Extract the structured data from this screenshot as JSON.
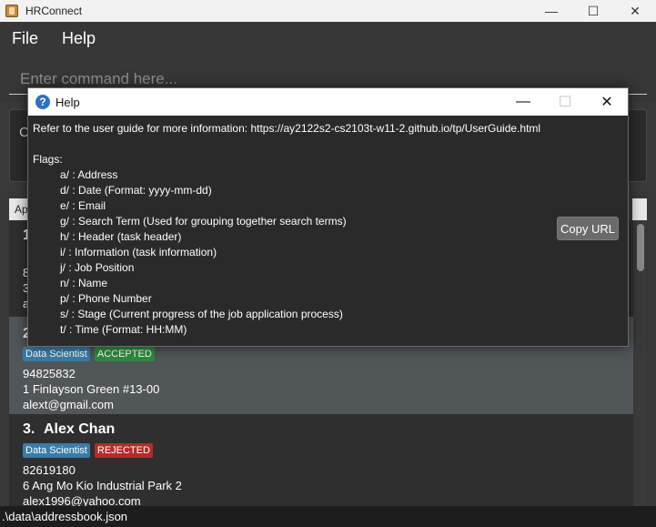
{
  "window": {
    "title": "HRConnect",
    "minimize": "—",
    "maximize": "☐",
    "close": "✕"
  },
  "menu": {
    "file": "File",
    "help": "Help"
  },
  "command": {
    "placeholder": "Enter command here..."
  },
  "result": {
    "partial_text": "C"
  },
  "list": {
    "tab_label": "Ap",
    "cards": [
      {
        "index": "1",
        "name": "",
        "lines": [
          "8",
          "3",
          "a"
        ],
        "tags": []
      },
      {
        "index": "2.",
        "name": "",
        "tags": [
          {
            "label": "Data Scientist",
            "color": "#3a7ca5"
          },
          {
            "label": "ACCEPTED",
            "color": "#2e8b3e"
          }
        ],
        "lines": [
          "94825832",
          "1 Finlayson Green #13-00",
          "alext@gmail.com"
        ]
      },
      {
        "index": "3.",
        "name": "Alex Chan",
        "tags": [
          {
            "label": "Data Scientist",
            "color": "#3a7ca5"
          },
          {
            "label": "REJECTED",
            "color": "#b52a2a"
          }
        ],
        "lines": [
          "82619180",
          "6 Ang Mo Kio Industrial Park 2",
          "alex1996@yahoo.com"
        ]
      }
    ]
  },
  "status": {
    "path": ".\\data\\addressbook.json"
  },
  "help_dialog": {
    "title": "Help",
    "minimize": "—",
    "maximize": "☐",
    "close": "✕",
    "text": "Refer to the user guide for more information: https://ay2122s2-cs2103t-w11-2.github.io/tp/UserGuide.html\n\nFlags:\n         a/ : Address\n         d/ : Date (Format: yyyy-mm-dd)\n         e/ : Email\n         g/ : Search Term (Used for grouping together search terms)\n         h/ : Header (task header)\n         i/ : Information (task information)\n         j/ : Job Position\n         n/ : Name\n         p/ : Phone Number\n         s/ : Stage (Current progress of the job application process)\n         t/ : Time (Format: HH:MM)",
    "copy_button": "Copy URL"
  }
}
